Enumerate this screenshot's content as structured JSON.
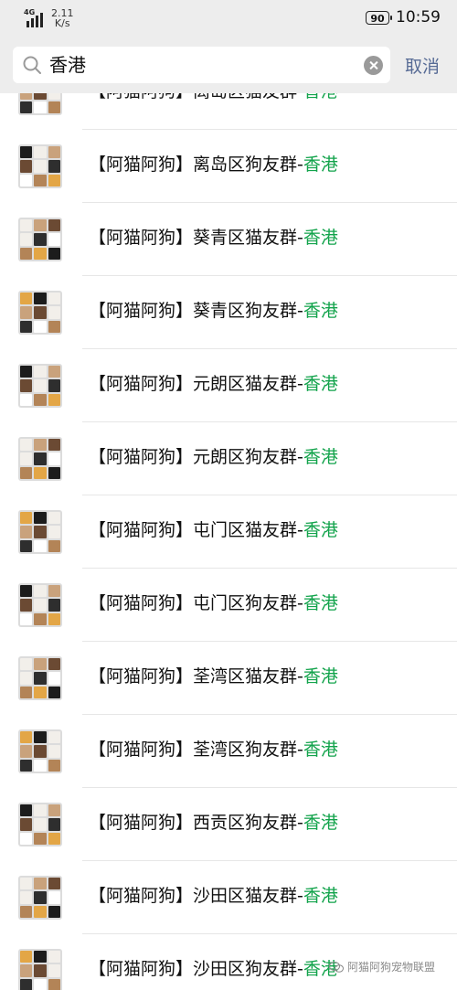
{
  "status_bar": {
    "network": "4G",
    "speed_value": "2.11",
    "speed_unit": "K/s",
    "battery": "90",
    "time": "10:59"
  },
  "search": {
    "query": "香港",
    "cancel_label": "取消"
  },
  "results": [
    {
      "prefix": "【阿猫阿狗】离岛区猫友群-",
      "highlight": "香港"
    },
    {
      "prefix": "【阿猫阿狗】离岛区狗友群-",
      "highlight": "香港"
    },
    {
      "prefix": "【阿猫阿狗】葵青区猫友群-",
      "highlight": "香港"
    },
    {
      "prefix": "【阿猫阿狗】葵青区狗友群-",
      "highlight": "香港"
    },
    {
      "prefix": "【阿猫阿狗】元朗区猫友群-",
      "highlight": "香港"
    },
    {
      "prefix": "【阿猫阿狗】元朗区狗友群-",
      "highlight": "香港"
    },
    {
      "prefix": "【阿猫阿狗】屯门区猫友群-",
      "highlight": "香港"
    },
    {
      "prefix": "【阿猫阿狗】屯门区狗友群-",
      "highlight": "香港"
    },
    {
      "prefix": "【阿猫阿狗】荃湾区猫友群-",
      "highlight": "香港"
    },
    {
      "prefix": "【阿猫阿狗】荃湾区狗友群-",
      "highlight": "香港"
    },
    {
      "prefix": "【阿猫阿狗】西贡区狗友群-",
      "highlight": "香港"
    },
    {
      "prefix": "【阿猫阿狗】沙田区猫友群-",
      "highlight": "香港"
    },
    {
      "prefix": "【阿猫阿狗】沙田区狗友群-",
      "highlight": "香港"
    }
  ],
  "watermark": "阿猫阿狗宠物联盟",
  "colors": {
    "highlight": "#12a34b",
    "cancel": "#576b95",
    "bar_bg": "#ededed"
  }
}
